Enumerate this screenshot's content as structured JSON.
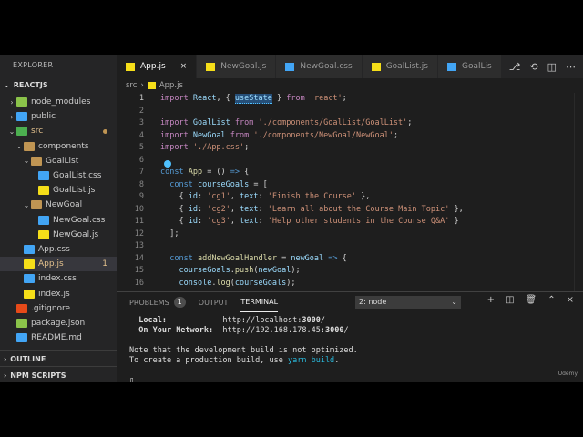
{
  "sidebar": {
    "title": "EXPLORER",
    "project": "REACTJS",
    "outline": "OUTLINE",
    "npm_scripts": "NPM SCRIPTS",
    "tree": [
      {
        "label": "node_modules",
        "depth": 1,
        "kind": "folder-green",
        "chev": "›"
      },
      {
        "label": "public",
        "depth": 1,
        "kind": "folder-blue",
        "chev": "›"
      },
      {
        "label": "src",
        "depth": 1,
        "kind": "folder-src",
        "chev": "⌄",
        "dot": true
      },
      {
        "label": "components",
        "depth": 2,
        "kind": "folder",
        "chev": "⌄"
      },
      {
        "label": "GoalList",
        "depth": 3,
        "kind": "folder",
        "chev": "⌄"
      },
      {
        "label": "GoalList.css",
        "depth": 4,
        "kind": "css"
      },
      {
        "label": "GoalList.js",
        "depth": 4,
        "kind": "js"
      },
      {
        "label": "NewGoal",
        "depth": 3,
        "kind": "folder",
        "chev": "⌄"
      },
      {
        "label": "NewGoal.css",
        "depth": 4,
        "kind": "css"
      },
      {
        "label": "NewGoal.js",
        "depth": 4,
        "kind": "js"
      },
      {
        "label": "App.css",
        "depth": 2,
        "kind": "css"
      },
      {
        "label": "App.js",
        "depth": 2,
        "kind": "js",
        "selected": true,
        "badge": "1"
      },
      {
        "label": "index.css",
        "depth": 2,
        "kind": "css"
      },
      {
        "label": "index.js",
        "depth": 2,
        "kind": "js"
      },
      {
        "label": ".gitignore",
        "depth": 1,
        "kind": "git"
      },
      {
        "label": "package.json",
        "depth": 1,
        "kind": "json"
      },
      {
        "label": "README.md",
        "depth": 1,
        "kind": "md"
      }
    ]
  },
  "tabs": [
    {
      "label": "App.js",
      "kind": "js",
      "active": true,
      "close": "×"
    },
    {
      "label": "NewGoal.js",
      "kind": "js"
    },
    {
      "label": "NewGoal.css",
      "kind": "css"
    },
    {
      "label": "GoalList.js",
      "kind": "js"
    },
    {
      "label": "GoalLis",
      "kind": "css"
    }
  ],
  "breadcrumb": {
    "folder": "src",
    "separator": "›",
    "file": "App.js"
  },
  "editor": {
    "lines": [
      {
        "n": "1",
        "html": "<span class='kw'>import</span> <span class='var'>React</span>, { <span class='var hl'>useState</span> } <span class='kw'>from</span> <span class='str'>'react'</span>;"
      },
      {
        "n": "2",
        "html": ""
      },
      {
        "n": "3",
        "html": "<span class='kw'>import</span> <span class='var'>GoalList</span> <span class='kw'>from</span> <span class='str'>'./components/GoalList/GoalList'</span>;"
      },
      {
        "n": "4",
        "html": "<span class='kw'>import</span> <span class='var'>NewGoal</span> <span class='kw'>from</span> <span class='str'>'./components/NewGoal/NewGoal'</span>;"
      },
      {
        "n": "5",
        "html": "<span class='kw'>import</span> <span class='str'>'./App.css'</span>;"
      },
      {
        "n": "6",
        "html": ""
      },
      {
        "n": "7",
        "html": "<span class='kw2'>const</span> <span class='fn'>App</span> = () <span class='kw2'>=></span> {"
      },
      {
        "n": "8",
        "html": "  <span class='kw2'>const</span> <span class='var'>courseGoals</span> = ["
      },
      {
        "n": "9",
        "html": "    { <span class='var'>id</span>: <span class='str'>'cg1'</span>, <span class='var'>text</span>: <span class='str'>'Finish the Course'</span> },"
      },
      {
        "n": "10",
        "html": "    { <span class='var'>id</span>: <span class='str'>'cg2'</span>, <span class='var'>text</span>: <span class='str'>'Learn all about the Course Main Topic'</span> },"
      },
      {
        "n": "11",
        "html": "    { <span class='var'>id</span>: <span class='str'>'cg3'</span>, <span class='var'>text</span>: <span class='str'>'Help other students in the Course Q&amp;A'</span> }"
      },
      {
        "n": "12",
        "html": "  ];"
      },
      {
        "n": "13",
        "html": ""
      },
      {
        "n": "14",
        "html": "  <span class='kw2'>const</span> <span class='fn'>addNewGoalHandler</span> = <span class='var'>newGoal</span> <span class='kw2'>=></span> {"
      },
      {
        "n": "15",
        "html": "    <span class='var'>courseGoals</span>.<span class='fn'>push</span>(<span class='var'>newGoal</span>);"
      },
      {
        "n": "16",
        "html": "    <span class='var'>console</span>.<span class='fn'>log</span>(<span class='var'>courseGoals</span>);"
      }
    ]
  },
  "panel": {
    "problems_label": "PROBLEMS",
    "problems_count": "1",
    "output_label": "OUTPUT",
    "terminal_label": "TERMINAL",
    "terminal_select": "2: node",
    "terminal_select_caret": "⌄",
    "terminal_lines": [
      {
        "html": "  <span class='bold'>Local:</span>            http://localhost:<span class='bold'>3000</span>/"
      },
      {
        "html": "  <span class='bold'>On Your Network:</span>  http://192.168.178.45:<span class='bold'>3000</span>/"
      },
      {
        "html": ""
      },
      {
        "html": "Note that the development build is not optimized."
      },
      {
        "html": "To create a production build, use <span class='cyan'>yarn build</span>."
      },
      {
        "html": ""
      },
      {
        "html": "▯"
      }
    ]
  },
  "watermark": "Udemy"
}
